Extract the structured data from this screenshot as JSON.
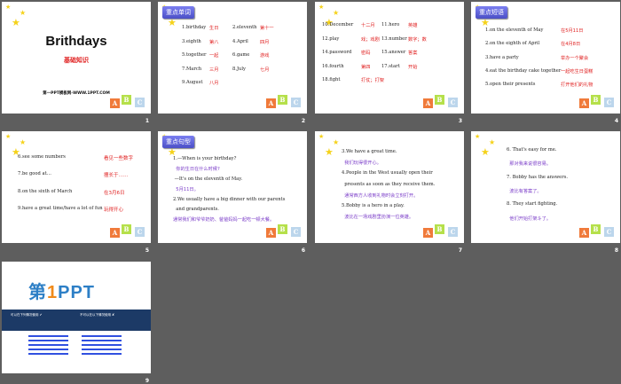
{
  "colors": {
    "background": "#5e5e5e",
    "red": "#e02020",
    "purple": "#7a3cc8",
    "badge": "#5a5ed8"
  },
  "slides": [
    {
      "number": "1",
      "type": "title",
      "title": "Brithdays",
      "subtitle": "基础知识",
      "footer": "第一PPT模板网-WWW.1PPT.COM"
    },
    {
      "number": "2",
      "type": "vocab",
      "badge": "重点单词",
      "rows": [
        [
          "1.birthday",
          "生日",
          "2.eleventh",
          "第十一"
        ],
        [
          "3.eighth",
          "第八",
          "4.April",
          "四月"
        ],
        [
          "5.together",
          "一起",
          "6.game",
          "游戏"
        ],
        [
          "7.March",
          "三月",
          "8.July",
          "七月"
        ],
        [
          "9.August",
          "八月",
          "",
          ""
        ]
      ]
    },
    {
      "number": "3",
      "type": "vocab",
      "rows": [
        [
          "10.December",
          "十二月",
          "11.hero",
          "英雄"
        ],
        [
          "12.play",
          "戏；戏剧",
          "13.number",
          "数字；数"
        ],
        [
          "14.password",
          "密码",
          "15.answer",
          "答案"
        ],
        [
          "16.fourth",
          "第四",
          "17.start",
          "开始"
        ],
        [
          "18.fight",
          "打仗；打架",
          "",
          ""
        ]
      ]
    },
    {
      "number": "4",
      "type": "phrase",
      "badge": "重点短语",
      "rows": [
        [
          "1.on the eleventh of May",
          "在5月11日"
        ],
        [
          "2.on the eighth of April",
          "在4月8日"
        ],
        [
          "3.have a party",
          "举办一个聚会"
        ],
        [
          "4.eat the birthday cake together",
          "一起吃生日蛋糕"
        ],
        [
          "5.open their presents",
          "打开他们的礼物"
        ]
      ]
    },
    {
      "number": "5",
      "type": "phrase",
      "rows": [
        [
          "6.see some numbers",
          "看见一些数字"
        ],
        [
          "7.be good at…",
          "擅长于……"
        ],
        [
          "8.on the sixth of March",
          "在3月6日"
        ],
        [
          "9.have a great time/have a lot of fun",
          "玩得开心"
        ]
      ]
    },
    {
      "number": "6",
      "type": "sentence",
      "badge": "重点句型",
      "lines": [
        [
          "en",
          "1.—When is your birthday?"
        ],
        [
          "pu",
          "  你的生日在什么时候?"
        ],
        [
          "en",
          " —It's on the eleventh of May."
        ],
        [
          "pu",
          "  5月11日。"
        ],
        [
          "en",
          "2.We usually have a big dinner with our parents"
        ],
        [
          "en",
          "  and grandparents."
        ],
        [
          "pu",
          "通常我们和爷爷奶奶、爸爸妈妈一起吃一顿大餐。"
        ]
      ]
    },
    {
      "number": "7",
      "type": "sentence",
      "lines": [
        [
          "en",
          "3.We have a great time."
        ],
        [
          "pu",
          "  我们玩得很开心。"
        ],
        [
          "en",
          "4.People in the West usually open their"
        ],
        [
          "en",
          "  presents as soon as they receive them."
        ],
        [
          "pu",
          "  通常西方人收到礼物时会立刻打开。"
        ],
        [
          "en",
          "5.Bobby is a hero in a play."
        ],
        [
          "pu",
          "  波比在一场戏剧里扮演一位英雄。"
        ]
      ]
    },
    {
      "number": "8",
      "type": "sentence",
      "lines": [
        [
          "en",
          "6. That's easy for me."
        ],
        [
          "pu",
          "  那对我来说很容易。"
        ],
        [
          "en",
          "7. Bobby has the answers."
        ],
        [
          "pu",
          "  波比有答案了。"
        ],
        [
          "en",
          "8. They start fighting."
        ],
        [
          "pu",
          "  他们开始打架斗了。"
        ]
      ]
    },
    {
      "number": "9",
      "type": "ad",
      "logo_a": "第",
      "logo_b": "1",
      "logo_c": "PPT",
      "band_left": "可以在下列情况使用 ✔",
      "band_right": "不可以在以下情况使用 ✘"
    }
  ]
}
